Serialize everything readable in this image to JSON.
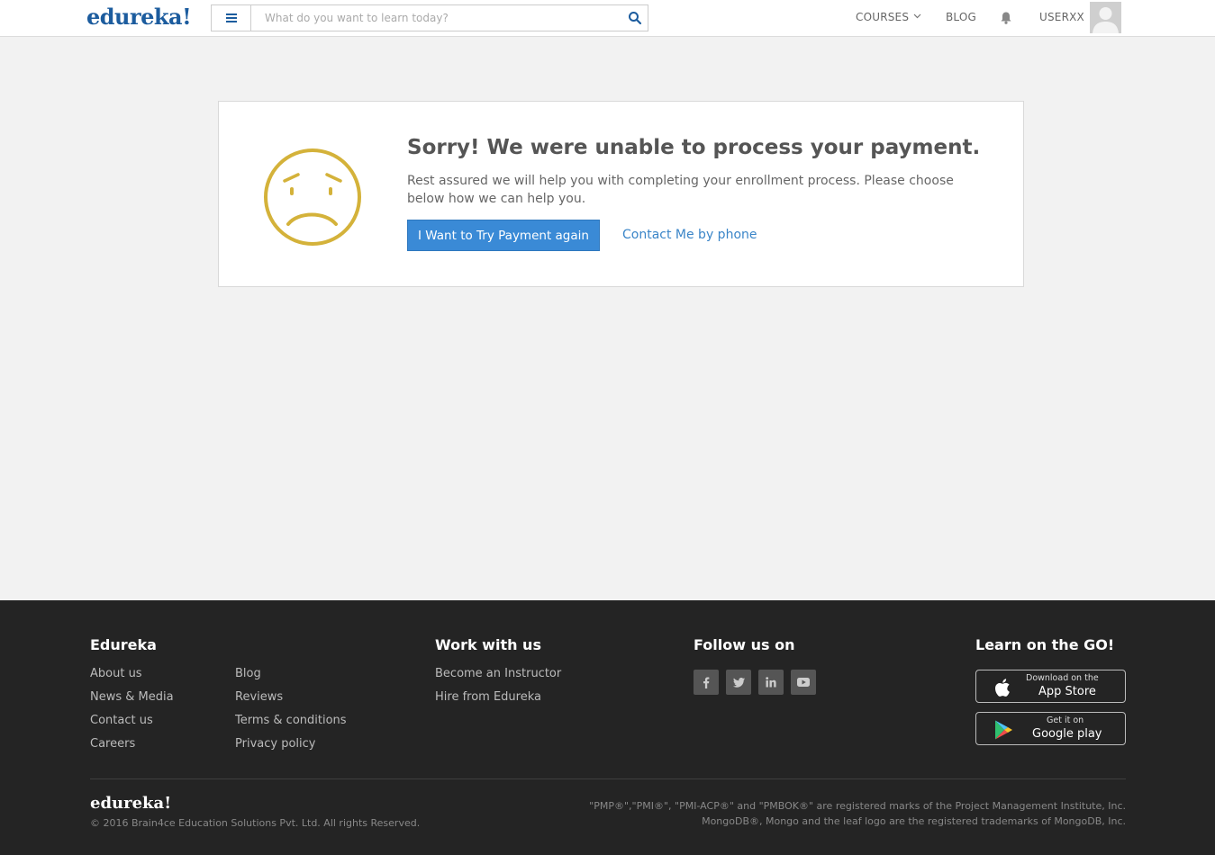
{
  "header": {
    "logo": "edureka!",
    "search": {
      "placeholder": "What do you want to learn today?"
    },
    "nav": {
      "courses": "COURSES",
      "blog": "BLOG",
      "user": "USERXX"
    }
  },
  "card": {
    "title": "Sorry! We were unable to process your payment.",
    "message": "Rest assured we will help you with completing your enrollment process. Please choose below how we can help you.",
    "retry_button": "I Want to Try Payment again",
    "phone_link": "Contact Me by phone",
    "icon_color": "#d4b23a"
  },
  "footer": {
    "col1": {
      "heading": "Edureka",
      "links_a": [
        "About us",
        "News & Media",
        "Contact us",
        "Careers"
      ],
      "links_b": [
        "Blog",
        "Reviews",
        "Terms & conditions",
        "Privacy policy"
      ]
    },
    "col2": {
      "heading": "Work with us",
      "links": [
        "Become an Instructor",
        "Hire from Edureka"
      ]
    },
    "col3": {
      "heading": "Follow us on",
      "icons": [
        "facebook-icon",
        "twitter-icon",
        "linkedin-icon",
        "youtube-icon"
      ]
    },
    "col4": {
      "heading": "Learn on the GO!",
      "app_store": {
        "small": "Download on the",
        "big": "App Store"
      },
      "google_play": {
        "small": "Get it on",
        "big": "Google play"
      }
    },
    "logo": "edureka!",
    "copyright": "© 2016 Brain4ce Education Solutions Pvt. Ltd. All rights Reserved.",
    "legal_1": "\"PMP®\",\"PMI®\", \"PMI-ACP®\" and \"PMBOK®\" are registered marks of the Project Management Institute, Inc.",
    "legal_2": "MongoDB®, Mongo and the leaf logo are the registered trademarks of MongoDB, Inc."
  },
  "colors": {
    "brand": "#1c5c9e",
    "button": "#3a8ad6",
    "footer_bg": "#242424"
  }
}
